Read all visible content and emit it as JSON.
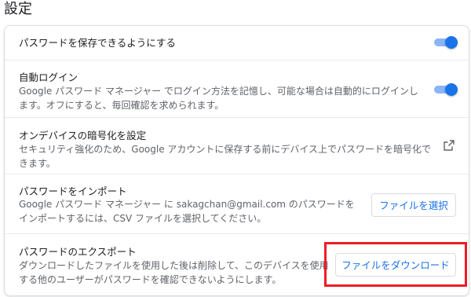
{
  "page_title": "設定",
  "rows": [
    {
      "title": "パスワードを保存できるようにする",
      "toggle": "on"
    },
    {
      "title": "自動ログイン",
      "description": "Google パスワード マネージャー でログイン方法を記憶し、可能な場合は自動的にログインします。オフにすると、毎回確認を求められます。",
      "toggle": "on"
    },
    {
      "title": "オンデバイスの暗号化を設定",
      "description": "セキュリティ強化のため、Google アカウントに保存する前にデバイス上でパスワードを暗号化できます。",
      "icon": "external-link-icon"
    },
    {
      "title": "パスワードをインポート",
      "description": "Google パスワード マネージャー に sakagchan@gmail.com のパスワードをインポートするには、CSV ファイルを選択してください。",
      "button": "ファイルを選択"
    },
    {
      "title": "パスワードのエクスポート",
      "description": "ダウンロードしたファイルを使用した後は削除して、このデバイスを使用する他のユーザーがパスワードを確認できないようにします。",
      "button": "ファイルをダウンロード"
    }
  ],
  "colors": {
    "accent": "#1a73e8",
    "toggle_track": "#8ab4f8",
    "highlight": "#ee1c25",
    "divider": "#e8eaed"
  }
}
